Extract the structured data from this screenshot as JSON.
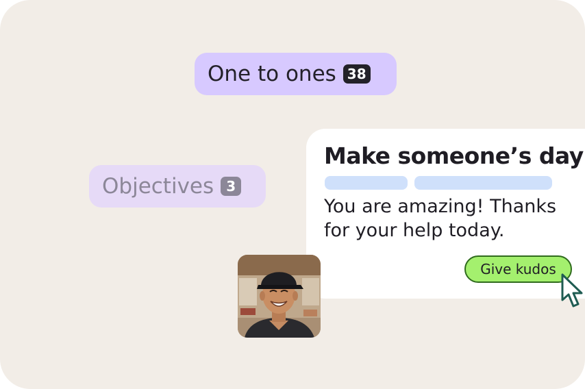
{
  "pills": {
    "one_to_ones": {
      "label": "One to ones",
      "count": "38"
    },
    "objectives": {
      "label": "Objectives",
      "count": "3"
    }
  },
  "kudos_card": {
    "title": "Make someone’s day",
    "message": "You are amazing! Thanks for your help today.",
    "button_label": "Give kudos"
  },
  "icons": {
    "cursor": "pointer-cursor-icon",
    "avatar": "person-photo"
  },
  "colors": {
    "background": "#f2ede7",
    "pill_active": "#d7c9ff",
    "pill_inactive": "#e6daf7",
    "kudos_button": "#a4f06e",
    "placeholder_bar": "#cfe0fb",
    "cursor_outline": "#1f5c52"
  }
}
